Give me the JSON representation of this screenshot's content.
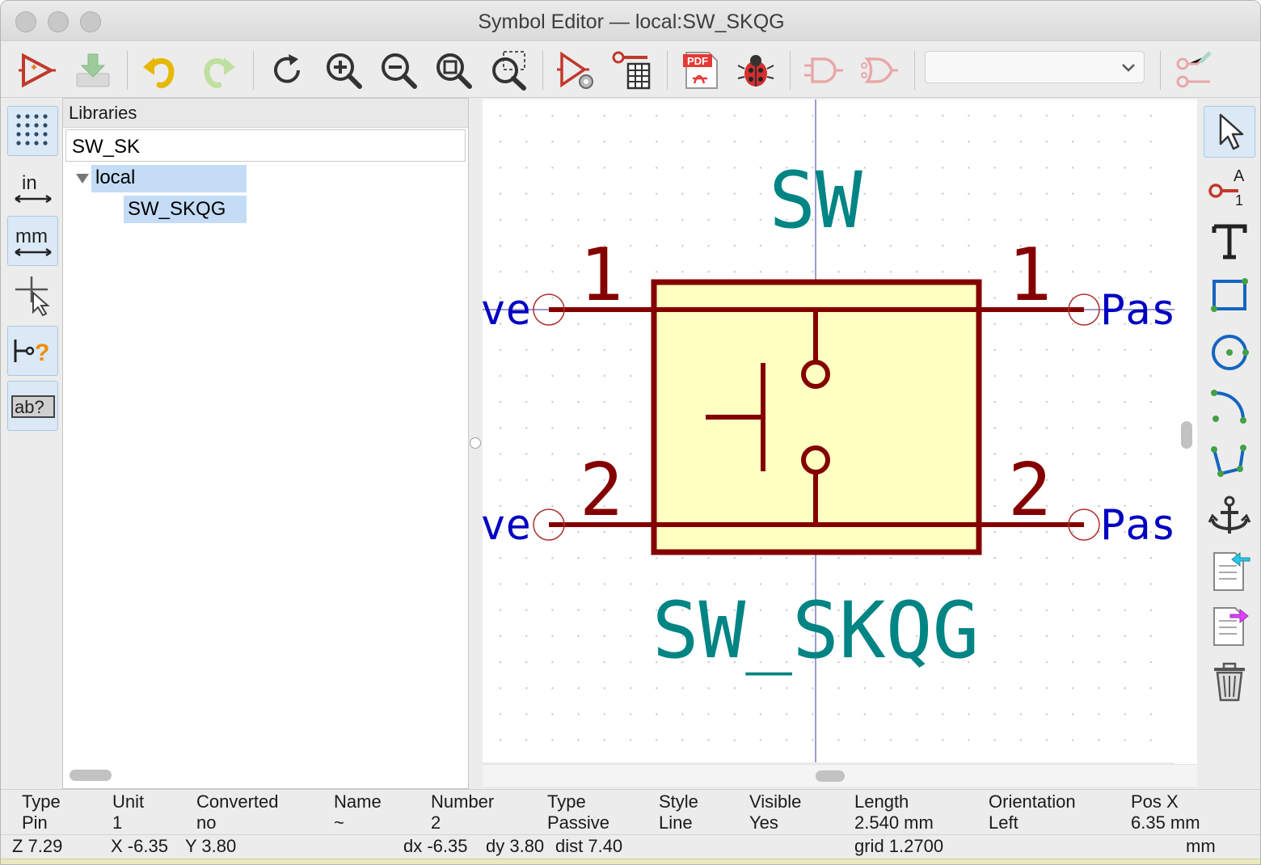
{
  "window": {
    "title": "Symbol Editor — local:SW_SKQG"
  },
  "toolbar": {
    "buttons": [
      "new-symbol-icon",
      "save-icon",
      "undo-icon",
      "redo-icon",
      "refresh-icon",
      "zoom-in-icon",
      "zoom-out-icon",
      "zoom-fit-icon",
      "zoom-selection-icon",
      "symbol-properties-icon",
      "pin-table-icon",
      "pdf-export-icon",
      "erc-bug-icon",
      "deMorgan-normal-icon",
      "deMorgan-alternate-icon",
      "pin-edit-icon"
    ],
    "unit_select_value": ""
  },
  "left_toolbar": {
    "buttons": [
      {
        "icon": "grid-icon",
        "active": true
      },
      {
        "icon": "inch-units-icon",
        "label": "in",
        "active": false
      },
      {
        "icon": "mm-units-icon",
        "label": "mm",
        "active": true
      },
      {
        "icon": "cursor-shape-icon",
        "active": false
      },
      {
        "icon": "pin-type-icon",
        "active": true
      },
      {
        "icon": "pin-name-icon",
        "label": "ab?",
        "active": true
      }
    ]
  },
  "libraries": {
    "header": "Libraries",
    "filter_value": "SW_SK",
    "tree": {
      "library": "local",
      "symbol": "SW_SKQG"
    }
  },
  "canvas": {
    "reference": "SW",
    "value": "SW_SKQG",
    "pin_left_top_number": "1",
    "pin_left_bottom_number": "2",
    "pin_right_top_number": "1",
    "pin_right_bottom_number": "2",
    "pin_left_top_name": "ve",
    "pin_left_bottom_name": "ve",
    "pin_right_top_name": "Pas",
    "pin_right_bottom_name": "Pas",
    "colors": {
      "body": "#840000",
      "fill": "#ffffc2",
      "text": "#008484",
      "pin_name": "#0000c2",
      "axis": "#4a4aa8"
    }
  },
  "message_panel": [
    {
      "label": "Type",
      "value": "Pin"
    },
    {
      "label": "Unit",
      "value": "1"
    },
    {
      "label": "Converted",
      "value": "no"
    },
    {
      "label": "Name",
      "value": "~"
    },
    {
      "label": "Number",
      "value": "2"
    },
    {
      "label": "Type",
      "value": "Passive"
    },
    {
      "label": "Style",
      "value": "Line"
    },
    {
      "label": "Visible",
      "value": "Yes"
    },
    {
      "label": "Length",
      "value": "2.540 mm"
    },
    {
      "label": "Orientation",
      "value": "Left"
    },
    {
      "label": "Pos X",
      "value": "6.35 mm"
    }
  ],
  "status": {
    "zoom": "Z 7.29",
    "x": "X -6.35",
    "y": "Y 3.80",
    "dx": "dx -6.35",
    "dy": "dy 3.80",
    "dist": "dist 7.40",
    "grid": "grid 1.2700",
    "units": "mm"
  }
}
